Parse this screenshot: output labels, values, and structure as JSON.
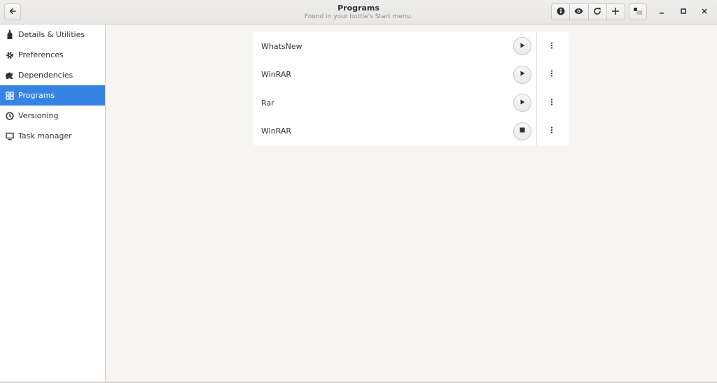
{
  "header": {
    "title": "Programs",
    "subtitle": "Found in your bottle's Start menu.",
    "back_icon": "arrow-left-icon",
    "actions": [
      {
        "icon": "info-icon"
      },
      {
        "icon": "eye-icon"
      },
      {
        "icon": "refresh-icon"
      },
      {
        "icon": "plus-icon"
      }
    ],
    "toggle_icon": "sidebar-toggle-icon",
    "window_controls": [
      "minimize",
      "maximize",
      "close"
    ]
  },
  "sidebar": {
    "items": [
      {
        "label": "Details & Utilities",
        "icon": "bottle-icon",
        "active": false
      },
      {
        "label": "Preferences",
        "icon": "gear-icon",
        "active": false
      },
      {
        "label": "Dependencies",
        "icon": "puzzle-icon",
        "active": false
      },
      {
        "label": "Programs",
        "icon": "grid-icon",
        "active": true
      },
      {
        "label": "Versioning",
        "icon": "clock-icon",
        "active": false
      },
      {
        "label": "Task manager",
        "icon": "monitor-icon",
        "active": false
      }
    ]
  },
  "programs": [
    {
      "name": "WhatsNew",
      "state": "play"
    },
    {
      "name": "WinRAR",
      "state": "play"
    },
    {
      "name": "Rar",
      "state": "play"
    },
    {
      "name": "WinRAR",
      "state": "stop"
    }
  ],
  "colors": {
    "accent": "#3584e4",
    "background": "#f6f5f4",
    "sidebar": "#ffffff"
  }
}
